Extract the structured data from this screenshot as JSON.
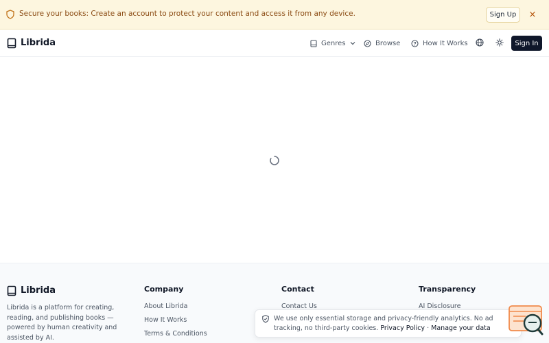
{
  "banner": {
    "message": "Secure your books: Create an account to protect your content and access it from any device.",
    "signup_label": "Sign Up",
    "close_glyph": "×",
    "shield_icon": "shield-icon",
    "color": "#8a4a12"
  },
  "header": {
    "brand": "Librida",
    "nav": {
      "genres": "Genres",
      "browse": "Browse",
      "how_it_works": "How It Works"
    },
    "signin_label": "Sign In",
    "accent": "#0f172a"
  },
  "main": {
    "loading_icon": "spinner-icon"
  },
  "footer": {
    "brand": "Librida",
    "description": "Librida is a platform for creating, reading, and publishing books — powered by human creativity and assisted by AI.",
    "company": {
      "title": "Company",
      "links": [
        "About Librida",
        "How It Works",
        "Terms & Conditions"
      ]
    },
    "contact": {
      "title": "Contact",
      "links": [
        "Contact Us"
      ]
    },
    "transparency": {
      "title": "Transparency",
      "links": [
        "AI Disclosure"
      ]
    }
  },
  "cookie": {
    "text": "We use only essential storage and privacy-friendly analytics. No ad tracking, no third-party cookies.",
    "privacy_link": "Privacy Policy",
    "separator": "·",
    "manage_link": "Manage your data"
  }
}
